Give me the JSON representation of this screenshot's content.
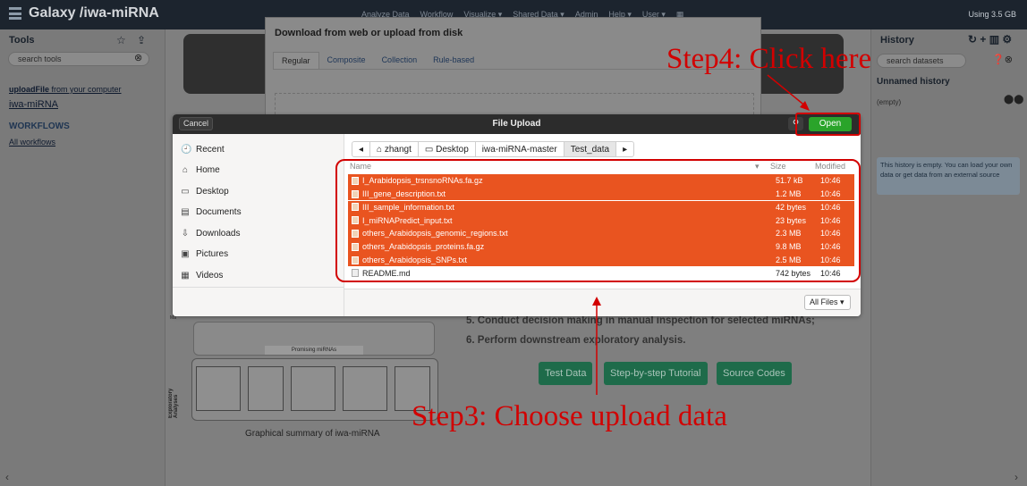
{
  "masthead": {
    "brand": "Galaxy /iwa-miRNA",
    "nav": [
      "Analyze Data",
      "Workflow",
      "Visualize ▾",
      "Shared Data ▾",
      "Admin",
      "Help ▾",
      "User ▾"
    ],
    "usage": "Using 3.5 GB"
  },
  "tools": {
    "title": "Tools",
    "search_placeholder": "search tools",
    "upload_bold": "uploadFile",
    "upload_rest": " from your computer",
    "section": "iwa-miRNA",
    "workflows_heading": "WORKFLOWS",
    "all_workflows": "All workflows"
  },
  "upload_modal": {
    "title": "Download from web or upload from disk",
    "tabs": [
      "Regular",
      "Composite",
      "Collection",
      "Rule-based"
    ]
  },
  "history": {
    "title": "History",
    "search_placeholder": "search datasets",
    "name": "Unnamed history",
    "status": "(empty)",
    "notice": "This history is empty. You can load your own data or get data from an external source"
  },
  "file_chooser": {
    "cancel": "Cancel",
    "title": "File Upload",
    "open": "Open",
    "places": [
      {
        "icon": "🕘",
        "label": "Recent"
      },
      {
        "icon": "⌂",
        "label": "Home"
      },
      {
        "icon": "▭",
        "label": "Desktop"
      },
      {
        "icon": "▤",
        "label": "Documents"
      },
      {
        "icon": "⇩",
        "label": "Downloads"
      },
      {
        "icon": "▣",
        "label": "Pictures"
      },
      {
        "icon": "▦",
        "label": "Videos"
      }
    ],
    "path": [
      "◂",
      "⌂ zhangt",
      "▭ Desktop",
      "iwa-miRNA-master",
      "Test_data",
      "▸"
    ],
    "headers": {
      "name": "Name",
      "size": "Size",
      "modified": "Modified"
    },
    "files": [
      {
        "name": "I_Arabidopsis_trsnsnoRNAs.fa.gz",
        "size": "51.7 kB",
        "modified": "10:46",
        "selected": true
      },
      {
        "name": "III_gene_description.txt",
        "size": "1.2 MB",
        "modified": "10:46",
        "selected": true
      },
      {
        "name": "III_sample_information.txt",
        "size": "42 bytes",
        "modified": "10:46",
        "selected": true
      },
      {
        "name": "I_miRNAPredict_input.txt",
        "size": "23 bytes",
        "modified": "10:46",
        "selected": true
      },
      {
        "name": "others_Arabidopsis_genomic_regions.txt",
        "size": "2.3 MB",
        "modified": "10:46",
        "selected": true
      },
      {
        "name": "others_Arabidopsis_proteins.fa.gz",
        "size": "9.8 MB",
        "modified": "10:46",
        "selected": true
      },
      {
        "name": "others_Arabidopsis_SNPs.txt",
        "size": "2.5 MB",
        "modified": "10:46",
        "selected": true
      },
      {
        "name": "README.md",
        "size": "742 bytes",
        "modified": "10:46",
        "selected": false
      }
    ],
    "filter": "All Files ▾"
  },
  "page": {
    "step5": "5. Conduct decision making in manual inspection for selected miRNAs;",
    "step6": "6. Perform downstream exploratory analysis.",
    "buttons": [
      "Test Data",
      "Step-by-step Tutorial",
      "Source Codes"
    ],
    "caption": "Graphical summary of iwa-miRNA",
    "promising": "Promising miRNAs",
    "exploratory": "Exploratory Analyses"
  },
  "annotations": {
    "step4": "Step4: Click here",
    "step3": "Step3: Choose upload data"
  },
  "colors": {
    "selection": "#e95420",
    "open_button": "#2aa42a",
    "annotation": "#d20000"
  }
}
